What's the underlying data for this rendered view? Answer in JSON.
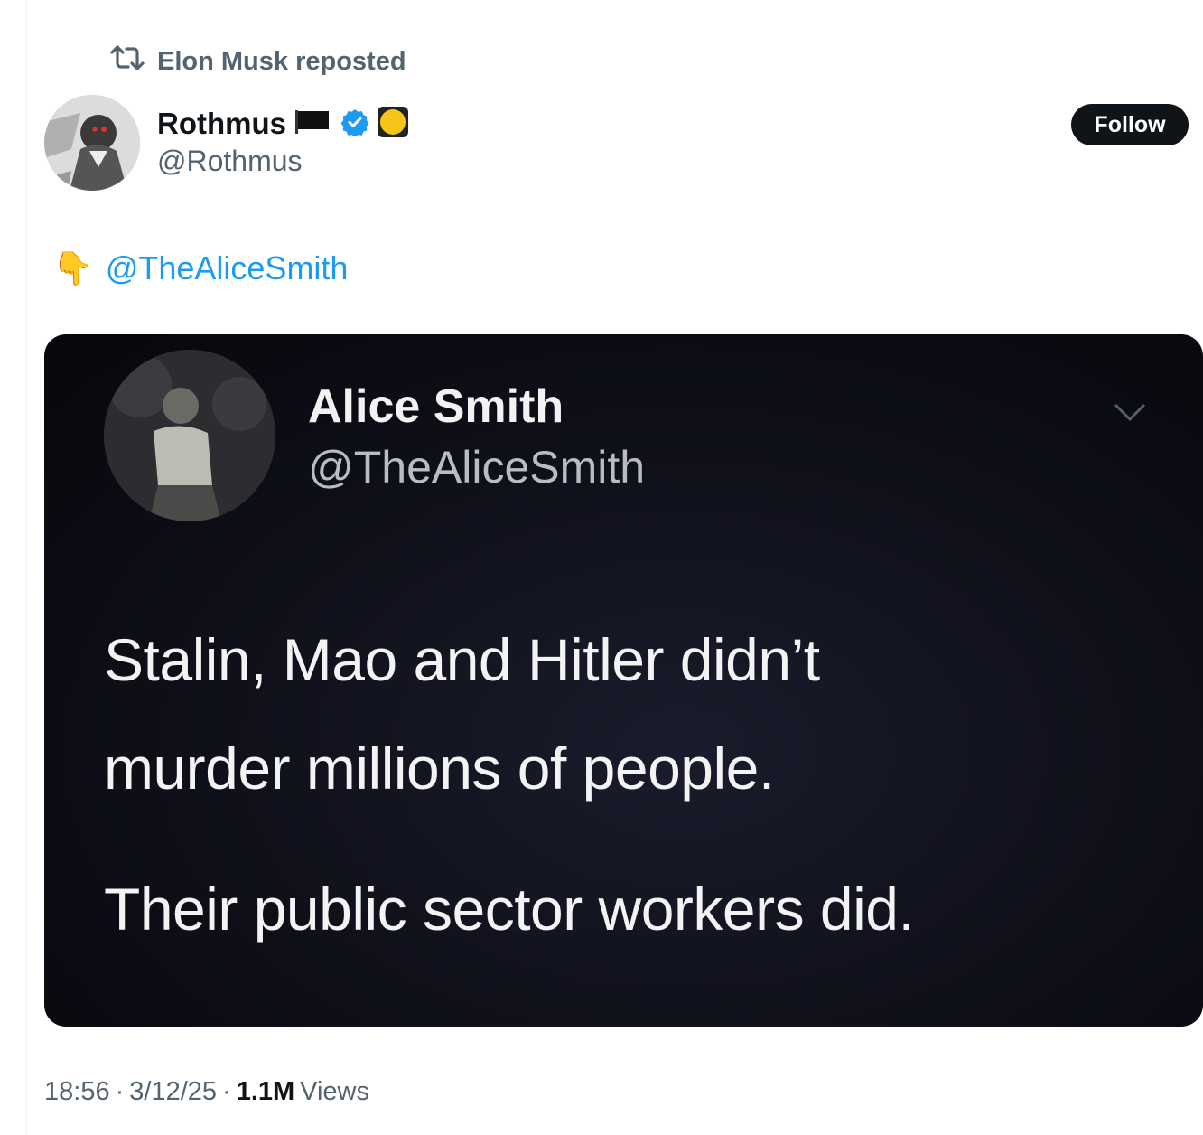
{
  "repost": {
    "text": "Elon Musk reposted",
    "icon": "repost-icon"
  },
  "author": {
    "display_name": "Rothmus",
    "handle": "@Rothmus",
    "badges": [
      "black-flag-icon",
      "verified-badge-icon",
      "yellow-circle-icon"
    ],
    "verified_color": "#1d9bf0"
  },
  "follow_button": {
    "label": "Follow"
  },
  "tweet": {
    "emoji": "👇",
    "mention": "@TheAliceSmith"
  },
  "embedded_image": {
    "name": "Alice Smith",
    "handle": "@TheAliceSmith",
    "lines": [
      "Stalin, Mao and Hitler didn’t",
      "murder millions of people.",
      "Their public sector workers did."
    ]
  },
  "meta": {
    "time": "18:56",
    "separator": "·",
    "date": "3/12/25",
    "views_count": "1.1M",
    "views_label": "Views"
  },
  "colors": {
    "accent": "#1d9bf0",
    "text": "#0f1419",
    "muted": "#536471"
  }
}
